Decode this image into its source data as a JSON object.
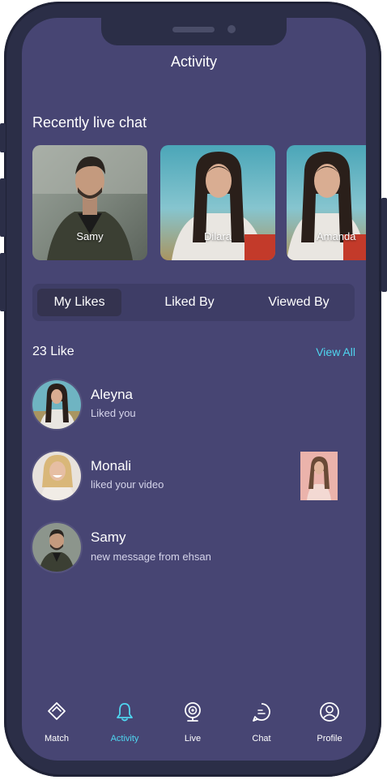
{
  "header": {
    "title": "Activity"
  },
  "recent_live": {
    "title": "Recently live chat",
    "cards": [
      {
        "name": "Samy"
      },
      {
        "name": "Dilara"
      },
      {
        "name": "Amanda"
      }
    ]
  },
  "tabs": [
    {
      "label": "My Likes",
      "active": true
    },
    {
      "label": "Liked By",
      "active": false
    },
    {
      "label": "Viewed By",
      "active": false
    }
  ],
  "likes": {
    "count_label": "23 Like",
    "view_all_label": "View All",
    "items": [
      {
        "name": "Aleyna",
        "message": "Liked you"
      },
      {
        "name": "Monali",
        "message": "liked your video"
      },
      {
        "name": "Samy",
        "message": "new message from ehsan"
      }
    ]
  },
  "bottom_nav": [
    {
      "label": "Match",
      "icon": "match-icon",
      "active": false
    },
    {
      "label": "Activity",
      "icon": "bell-icon",
      "active": true
    },
    {
      "label": "Live",
      "icon": "webcam-icon",
      "active": false
    },
    {
      "label": "Chat",
      "icon": "chat-bubble-icon",
      "active": false
    },
    {
      "label": "Profile",
      "icon": "user-icon",
      "active": false
    }
  ],
  "colors": {
    "background": "#474573",
    "accent": "#4fd6f0",
    "tab_bar": "#3e3d66",
    "frame": "#2b2e47"
  }
}
